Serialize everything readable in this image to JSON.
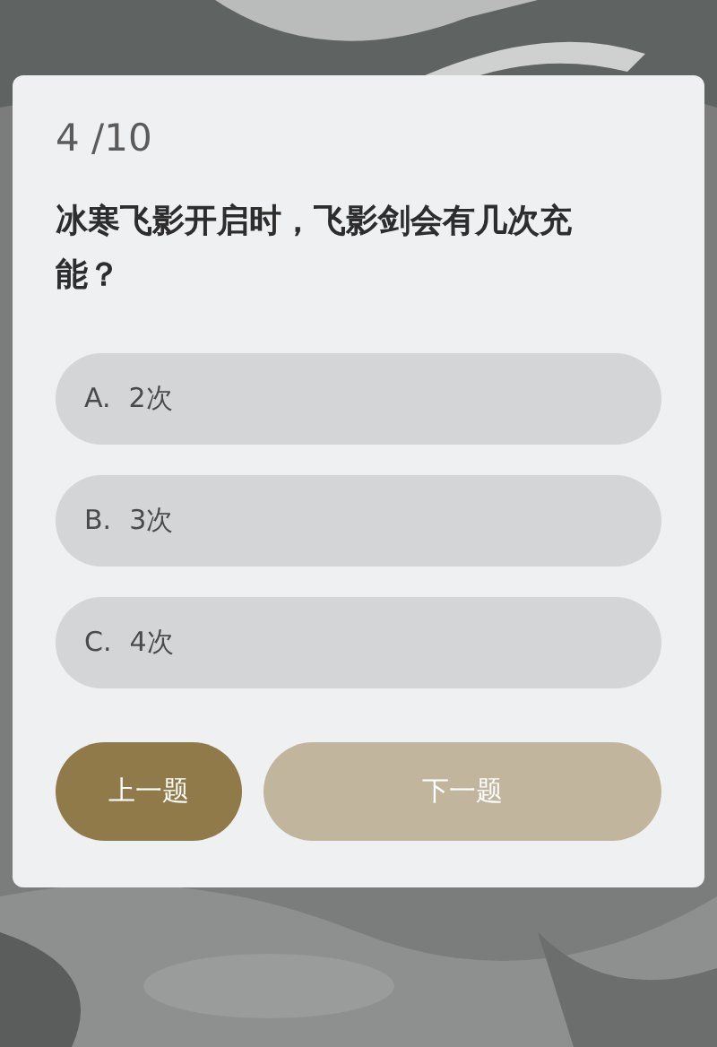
{
  "progress": "4 /10",
  "question": "冰寒飞影开启时，飞影剑会有几次充能？",
  "options": [
    {
      "letter": "A.",
      "text": "2次",
      "selected": false
    },
    {
      "letter": "B.",
      "text": "3次",
      "selected": false
    },
    {
      "letter": "C.",
      "text": "4次",
      "selected": false
    }
  ],
  "buttons": [
    {
      "kind": "prev",
      "label": "上一题",
      "disabled": false
    },
    {
      "kind": "next",
      "label": "下一题",
      "disabled": true
    }
  ]
}
